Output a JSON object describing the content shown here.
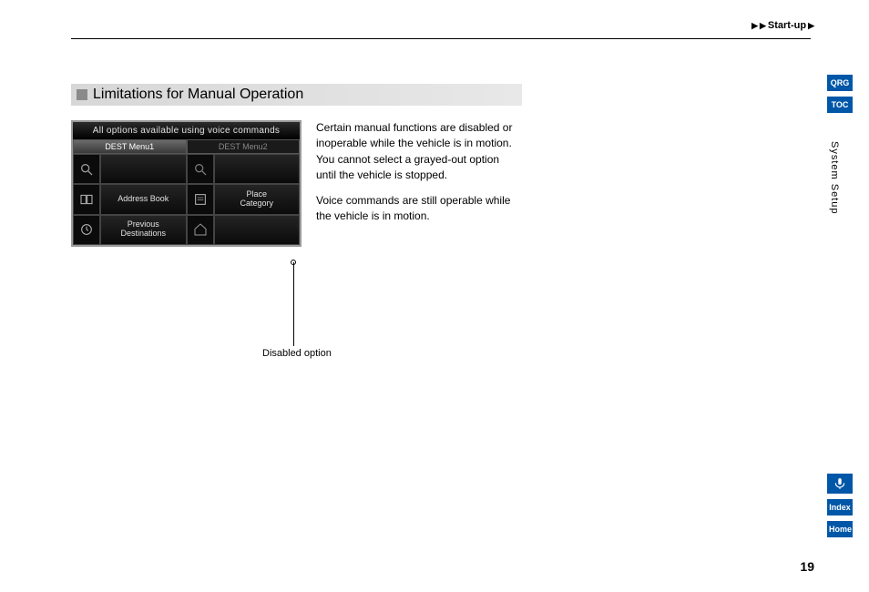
{
  "breadcrumb": {
    "label": "Start-up"
  },
  "sideTabs": {
    "top": [
      {
        "label": "QRG"
      },
      {
        "label": "TOC"
      }
    ],
    "bottom": [
      {
        "label": "Index"
      },
      {
        "label": "Home"
      }
    ]
  },
  "sectionLabel": "System Setup",
  "pageNumber": "19",
  "heading": "Limitations for Manual Operation",
  "paragraphs": {
    "p1": "Certain manual functions are disabled or inoperable while the vehicle is in motion. You cannot select a grayed-out option until the vehicle is stopped.",
    "p2": "Voice commands are still operable while the vehicle is in motion."
  },
  "mock": {
    "banner": "All options available using voice commands",
    "tabs": {
      "tab1": "DEST Menu1",
      "tab2": "DEST Menu2"
    },
    "cells": {
      "addressBook": "Address Book",
      "placeCategory": "Place\nCategory",
      "previousDestinations": "Previous\nDestinations"
    }
  },
  "callout": "Disabled option"
}
